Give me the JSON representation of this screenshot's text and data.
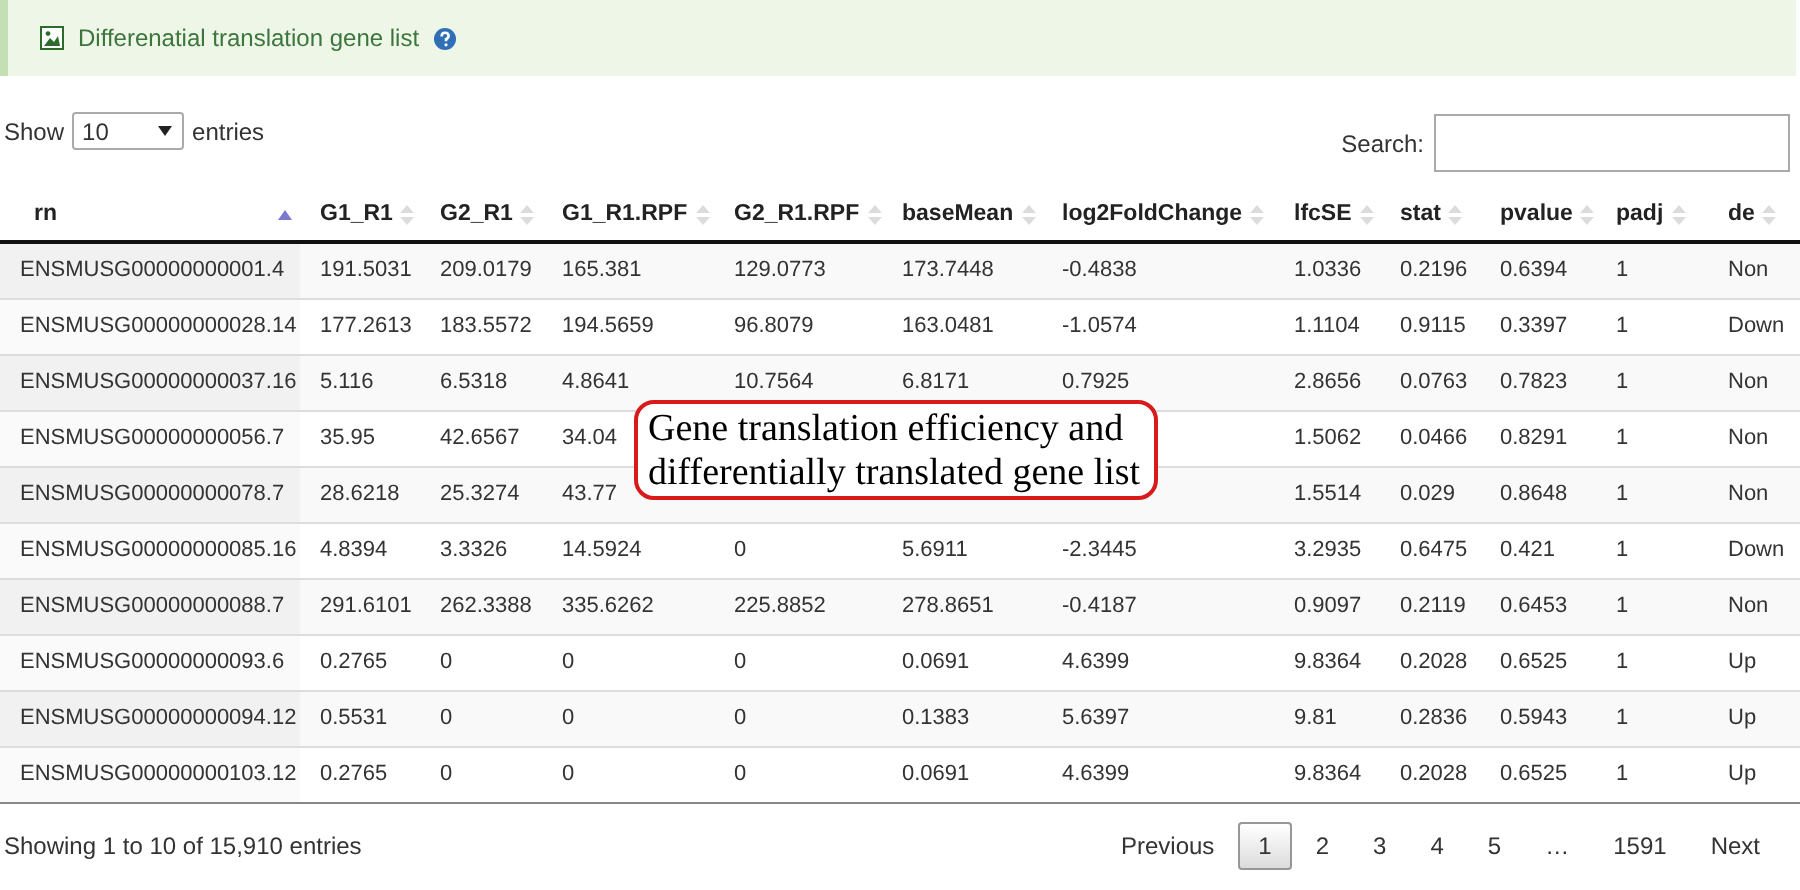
{
  "panel": {
    "title": "Differenatial translation gene list"
  },
  "length": {
    "label_before": "Show",
    "value": "10",
    "label_after": "entries"
  },
  "search": {
    "label": "Search:"
  },
  "table": {
    "columns": [
      {
        "label": "rn",
        "sorted": true
      },
      {
        "label": "G1_R1",
        "sorted": false
      },
      {
        "label": "G2_R1",
        "sorted": false
      },
      {
        "label": "G1_R1.RPF",
        "sorted": false
      },
      {
        "label": "G2_R1.RPF",
        "sorted": false
      },
      {
        "label": "baseMean",
        "sorted": false
      },
      {
        "label": "log2FoldChange",
        "sorted": false
      },
      {
        "label": "lfcSE",
        "sorted": false
      },
      {
        "label": "stat",
        "sorted": false
      },
      {
        "label": "pvalue",
        "sorted": false
      },
      {
        "label": "padj",
        "sorted": false
      },
      {
        "label": "de",
        "sorted": false
      }
    ],
    "rows": [
      [
        "ENSMUSG00000000001.4",
        "191.5031",
        "209.0179",
        "165.381",
        "129.0773",
        "173.7448",
        "-0.4838",
        "1.0336",
        "0.2196",
        "0.6394",
        "1",
        "Non"
      ],
      [
        "ENSMUSG00000000028.14",
        "177.2613",
        "183.5572",
        "194.5659",
        "96.8079",
        "163.0481",
        "-1.0574",
        "1.1104",
        "0.9115",
        "0.3397",
        "1",
        "Down"
      ],
      [
        "ENSMUSG00000000037.16",
        "5.116",
        "6.5318",
        "4.8641",
        "10.7564",
        "6.8171",
        "0.7925",
        "2.8656",
        "0.0763",
        "0.7823",
        "1",
        "Non"
      ],
      [
        "ENSMUSG00000000056.7",
        "35.95",
        "42.6567",
        "34.04",
        null,
        null,
        null,
        "1.5062",
        "0.0466",
        "0.8291",
        "1",
        "Non"
      ],
      [
        "ENSMUSG00000000078.7",
        "28.6218",
        "25.3274",
        "43.77",
        null,
        null,
        null,
        "1.5514",
        "0.029",
        "0.8648",
        "1",
        "Non"
      ],
      [
        "ENSMUSG00000000085.16",
        "4.8394",
        "3.3326",
        "14.5924",
        "0",
        "5.6911",
        "-2.3445",
        "3.2935",
        "0.6475",
        "0.421",
        "1",
        "Down"
      ],
      [
        "ENSMUSG00000000088.7",
        "291.6101",
        "262.3388",
        "335.6262",
        "225.8852",
        "278.8651",
        "-0.4187",
        "0.9097",
        "0.2119",
        "0.6453",
        "1",
        "Non"
      ],
      [
        "ENSMUSG00000000093.6",
        "0.2765",
        "0",
        "0",
        "0",
        "0.0691",
        "4.6399",
        "9.8364",
        "0.2028",
        "0.6525",
        "1",
        "Up"
      ],
      [
        "ENSMUSG00000000094.12",
        "0.5531",
        "0",
        "0",
        "0",
        "0.1383",
        "5.6397",
        "9.81",
        "0.2836",
        "0.5943",
        "1",
        "Up"
      ],
      [
        "ENSMUSG00000000103.12",
        "0.2765",
        "0",
        "0",
        "0",
        "0.0691",
        "4.6399",
        "9.8364",
        "0.2028",
        "0.6525",
        "1",
        "Up"
      ]
    ]
  },
  "info": "Showing 1 to 10 of 15,910 entries",
  "pagination": [
    {
      "label": "Previous",
      "selected": false
    },
    {
      "label": "1",
      "selected": true
    },
    {
      "label": "2",
      "selected": false
    },
    {
      "label": "3",
      "selected": false
    },
    {
      "label": "4",
      "selected": false
    },
    {
      "label": "5",
      "selected": false
    },
    {
      "label": "…",
      "selected": false
    },
    {
      "label": "1591",
      "selected": false
    },
    {
      "label": "Next",
      "selected": false
    }
  ],
  "callout": "Gene translation efficiency and differentially translated gene list"
}
